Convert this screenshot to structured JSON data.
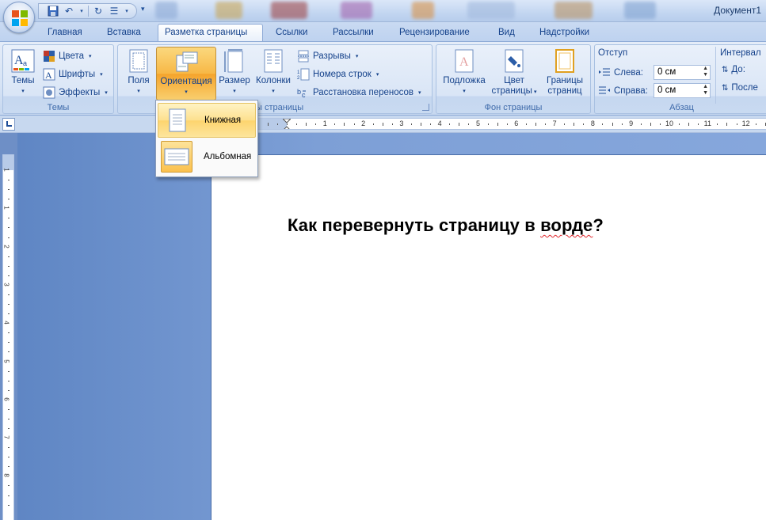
{
  "window": {
    "title": "Документ1"
  },
  "tabs": [
    {
      "label": "Главная"
    },
    {
      "label": "Вставка"
    },
    {
      "label": "Разметка страницы"
    },
    {
      "label": "Ссылки"
    },
    {
      "label": "Рассылки"
    },
    {
      "label": "Рецензирование"
    },
    {
      "label": "Вид"
    },
    {
      "label": "Надстройки"
    }
  ],
  "active_tab": "Разметка страницы",
  "ribbon": {
    "themes": {
      "group_label": "Темы",
      "themes_button": "Темы",
      "colors": "Цвета",
      "fonts": "Шрифты",
      "effects": "Эффекты"
    },
    "page_setup": {
      "group_label_partial": "ры страницы",
      "margins": "Поля",
      "orientation": "Ориентация",
      "size": "Размер",
      "columns": "Колонки",
      "breaks": "Разрывы",
      "line_numbers": "Номера строк",
      "hyphenation": "Расстановка переносов"
    },
    "page_background": {
      "group_label": "Фон страницы",
      "watermark": "Подложка",
      "page_color_line1": "Цвет",
      "page_color_line2": "страницы",
      "page_borders_line1": "Границы",
      "page_borders_line2": "страниц"
    },
    "paragraph": {
      "group_label": "Абзац",
      "indent_label": "Отступ",
      "left_label": "Слева:",
      "left_value": "0 см",
      "right_label": "Справа:",
      "right_value": "0 см",
      "spacing_label": "Интервал",
      "before_label": "До:",
      "after_label": "После"
    }
  },
  "orientation_menu": {
    "items": [
      {
        "label": "Книжная",
        "highlighted": true
      },
      {
        "label": "Альбомная",
        "selected": true
      }
    ]
  },
  "ruler": {
    "numbers": [
      "1",
      "2",
      "3",
      "4",
      "5",
      "6",
      "7",
      "8",
      "9",
      "10",
      "11",
      "12"
    ],
    "vertical_numbers": [
      "1",
      "1",
      "2",
      "3",
      "4",
      "5",
      "6",
      "7",
      "8"
    ]
  },
  "document": {
    "heading": "Как перевернуть страницу в ",
    "misspelled_word": "ворде",
    "heading_end": "?"
  },
  "colors": {
    "accent_hover": "#fdd46e",
    "pressed": "#f7b846",
    "ribbon_text": "#15428b",
    "spellcheck": "#e0262c"
  }
}
